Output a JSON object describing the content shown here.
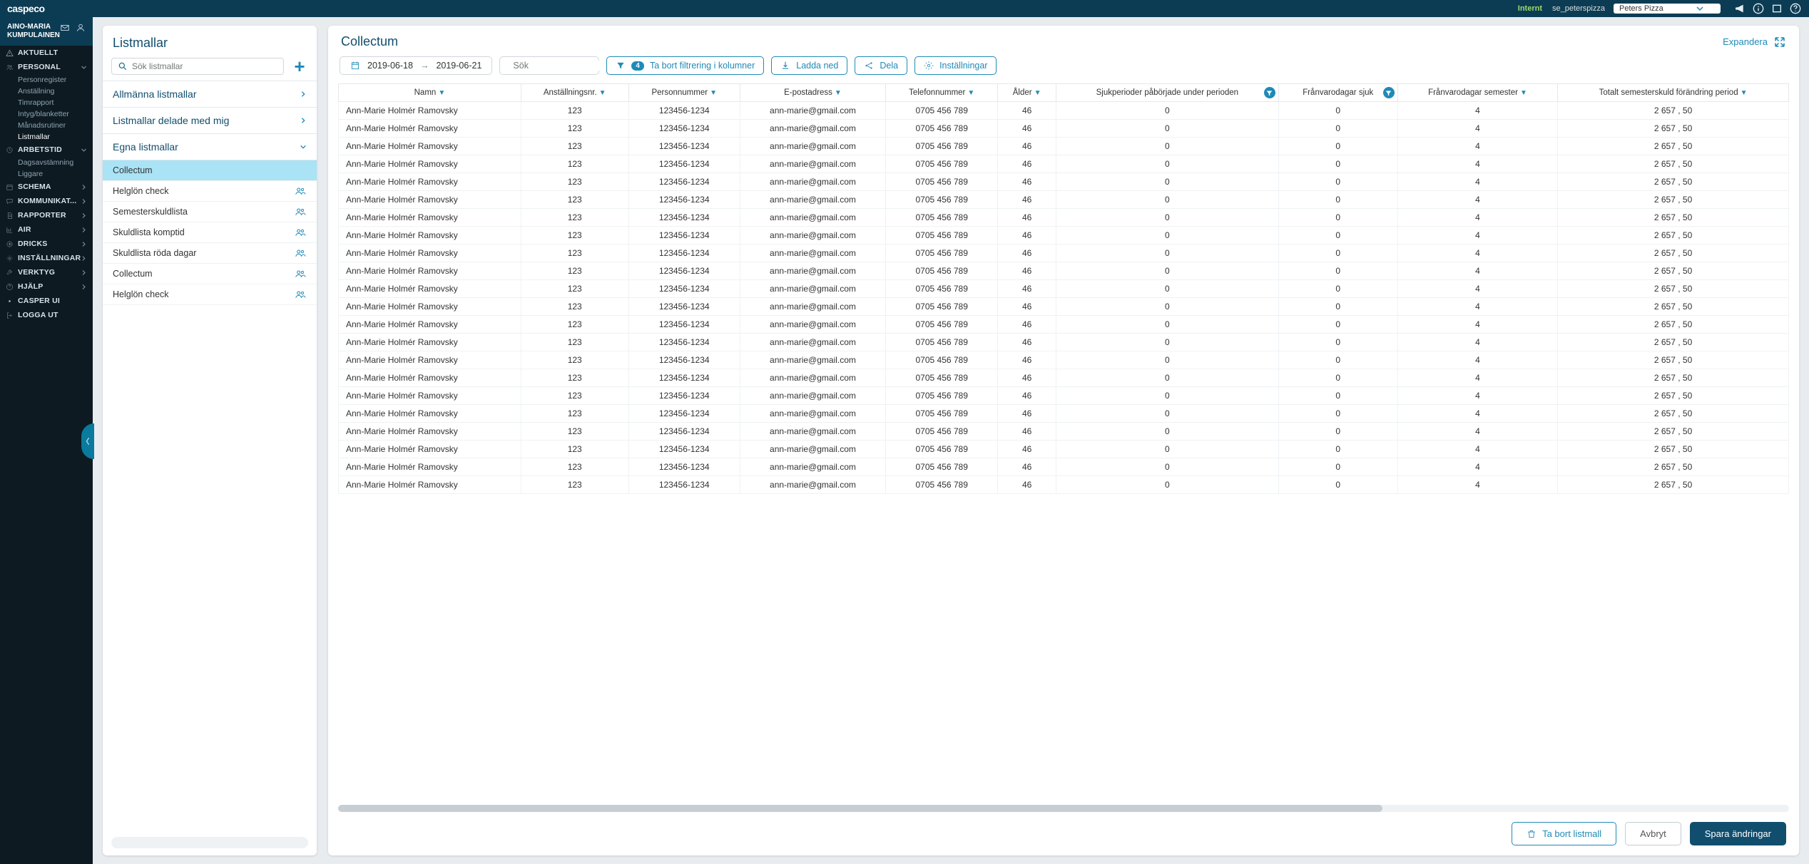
{
  "topbar": {
    "brand": "caspeco",
    "env": "Internt",
    "seid": "se_peterspizza",
    "tenant": "Peters Pizza"
  },
  "user": {
    "name": "AINO-MARIA KUMPULAINEN"
  },
  "leftnav": [
    {
      "icon": "warn",
      "label": "AKTUELLT"
    },
    {
      "icon": "users",
      "label": "PERSONAL",
      "expanded": true,
      "children": [
        {
          "label": "Personregister"
        },
        {
          "label": "Anställning"
        },
        {
          "label": "Timrapport"
        },
        {
          "label": "Intyg/blanketter"
        },
        {
          "label": "Månadsrutiner"
        },
        {
          "label": "Listmallar",
          "active": true
        }
      ]
    },
    {
      "icon": "clock",
      "label": "ARBETSTID",
      "expanded": true,
      "children": [
        {
          "label": "Dagsavstämning"
        },
        {
          "label": "Liggare"
        }
      ]
    },
    {
      "icon": "cal",
      "label": "SCHEMA",
      "chev": true
    },
    {
      "icon": "chat",
      "label": "KOMMUNIKAT...",
      "chev": true
    },
    {
      "icon": "doc",
      "label": "RAPPORTER",
      "chev": true
    },
    {
      "icon": "chart",
      "label": "AIR",
      "chev": true
    },
    {
      "icon": "coin",
      "label": "DRICKS",
      "chev": true
    },
    {
      "icon": "gear",
      "label": "INSTÄLLNINGAR",
      "chev": true
    },
    {
      "icon": "wrench",
      "label": "VERKTYG",
      "chev": true
    },
    {
      "icon": "help",
      "label": "HJÄLP",
      "chev": true
    },
    {
      "icon": "dot",
      "label": "CASPER UI"
    },
    {
      "icon": "logout",
      "label": "LOGGA UT"
    }
  ],
  "listPanel": {
    "title": "Listmallar",
    "searchPlaceholder": "Sök listmallar",
    "sections": [
      {
        "label": "Allmänna listmallar",
        "open": false
      },
      {
        "label": "Listmallar delade med mig",
        "open": false
      },
      {
        "label": "Egna listmallar",
        "open": true,
        "items": [
          {
            "label": "Collectum",
            "selected": true
          },
          {
            "label": "Helglön check",
            "shared": true
          },
          {
            "label": "Semesterskuldlista",
            "shared": true
          },
          {
            "label": "Skuldlista komptid",
            "shared": true
          },
          {
            "label": "Skuldlista röda dagar",
            "shared": true
          },
          {
            "label": "Collectum",
            "shared": true
          },
          {
            "label": "Helglön check",
            "shared": true
          }
        ]
      }
    ]
  },
  "main": {
    "title": "Collectum",
    "expandLabel": "Expandera",
    "dateFrom": "2019-06-18",
    "dateTo": "2019-06-21",
    "searchPlaceholder": "Sök",
    "filterCount": "4",
    "filterLabel": "Ta bort filtrering i kolumner",
    "downloadLabel": "Ladda ned",
    "shareLabel": "Dela",
    "settingsLabel": "Inställningar",
    "columns": [
      {
        "label": "Namn",
        "sort": true
      },
      {
        "label": "Anställningsnr.",
        "sort": true
      },
      {
        "label": "Personnummer",
        "sort": true
      },
      {
        "label": "E-postadress",
        "sort": true
      },
      {
        "label": "Telefonnummer",
        "sort": true
      },
      {
        "label": "Ålder",
        "sort": true
      },
      {
        "label": "Sjukperioder påbörjade under perioden",
        "sort": false,
        "filter": true
      },
      {
        "label": "Frånvarodagar sjuk",
        "sort": false,
        "filter": true
      },
      {
        "label": "Frånvarodagar semester",
        "sort": true
      },
      {
        "label": "Totalt semesterskuld förändring period",
        "sort": true
      }
    ],
    "row": {
      "name": "Ann-Marie Holmér Ramovsky",
      "empno": "123",
      "pnr": "123456-1234",
      "email": "ann-marie@gmail.com",
      "phone": "0705 456 789",
      "age": "46",
      "sick_periods": "0",
      "absent_sick": "0",
      "absent_vac": "4",
      "vac_debt": "2 657 , 50"
    },
    "rowCount": 22,
    "footer": {
      "delete": "Ta bort listmall",
      "cancel": "Avbryt",
      "save": "Spara ändringar"
    }
  }
}
